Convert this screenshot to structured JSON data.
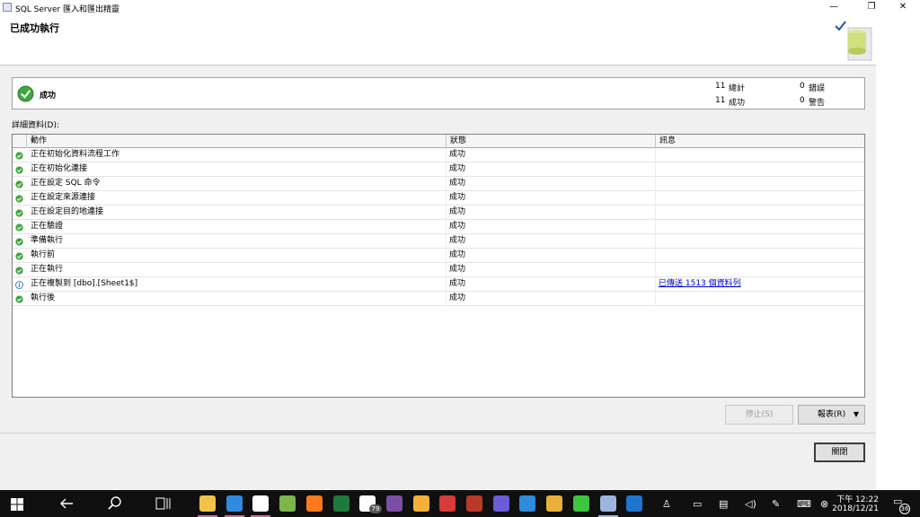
{
  "window": {
    "title": "SQL Server 匯入和匯出精靈",
    "minimize": "—",
    "maximize": "❐",
    "close": "✕"
  },
  "header": {
    "title": "已成功執行"
  },
  "summary": {
    "status": "成功",
    "total_value": "11",
    "total_label": "總計",
    "success_value": "11",
    "success_label": "成功",
    "error_value": "0",
    "error_label": "錯誤",
    "warning_value": "0",
    "warning_label": "警告"
  },
  "details": {
    "label": "詳細資料(D):",
    "columns": [
      "動作",
      "狀態",
      "訊息"
    ],
    "rows": [
      {
        "icon": "success",
        "action": "正在初始化資料流程工作",
        "status": "成功",
        "message": ""
      },
      {
        "icon": "success",
        "action": "正在初始化連接",
        "status": "成功",
        "message": ""
      },
      {
        "icon": "success",
        "action": "正在設定 SQL 命令",
        "status": "成功",
        "message": ""
      },
      {
        "icon": "success",
        "action": "正在設定來源連接",
        "status": "成功",
        "message": ""
      },
      {
        "icon": "success",
        "action": "正在設定目的地連接",
        "status": "成功",
        "message": ""
      },
      {
        "icon": "success",
        "action": "正在驗證",
        "status": "成功",
        "message": ""
      },
      {
        "icon": "success",
        "action": "準備執行",
        "status": "成功",
        "message": ""
      },
      {
        "icon": "success",
        "action": "執行前",
        "status": "成功",
        "message": ""
      },
      {
        "icon": "success",
        "action": "正在執行",
        "status": "成功",
        "message": ""
      },
      {
        "icon": "info",
        "action": "正在複製到 [dbo].[Sheet1$]",
        "status": "成功",
        "message": "已傳送 1513 個資料列"
      },
      {
        "icon": "success",
        "action": "執行後",
        "status": "成功",
        "message": ""
      }
    ]
  },
  "buttons": {
    "stop": "停止(S)",
    "report": "報表(R)",
    "report_arrow": "▼",
    "close": "關閉"
  },
  "taskbar": {
    "clock_time": "下午 12:22",
    "clock_date": "2018/12/21",
    "notification_count": "36",
    "badge_count": "79",
    "apps": [
      "file-explorer",
      "hwp",
      "chrome-app",
      "notepad",
      "firefox",
      "excel",
      "mail",
      "visual-studio",
      "paint",
      "app-red",
      "app-spider",
      "eclipse",
      "edge",
      "chrome",
      "line",
      "ssms",
      "edge-2"
    ]
  },
  "colors": {
    "success": "#3fa63f",
    "info": "#2b6fc7",
    "taskbar": "#101010",
    "link": "#0000cc"
  }
}
